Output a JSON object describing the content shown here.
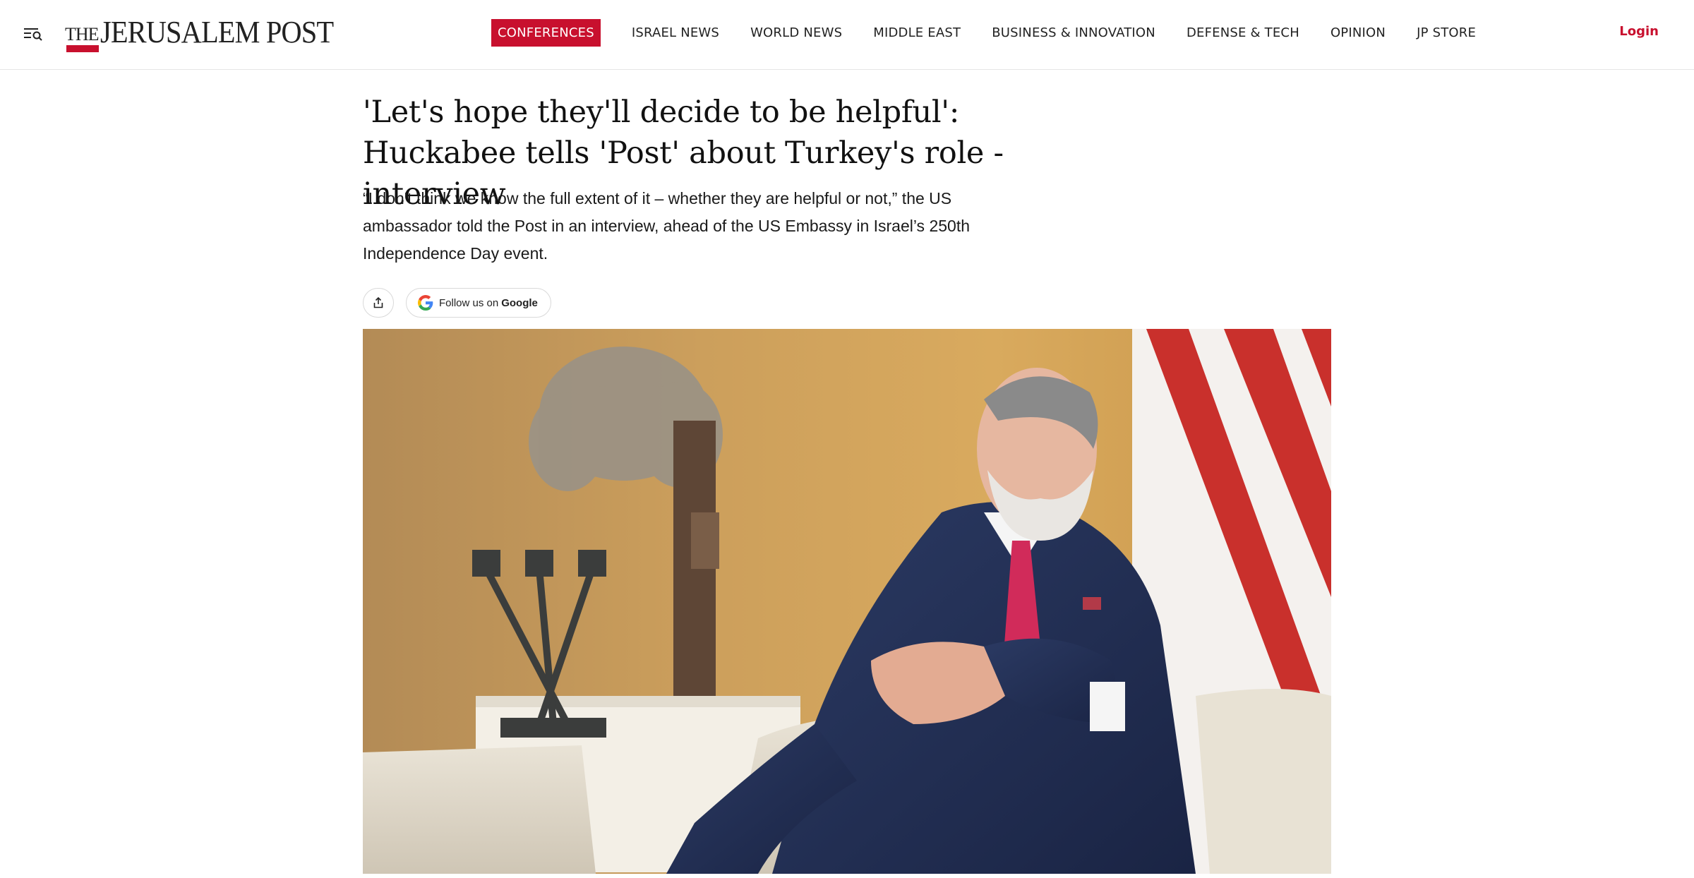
{
  "header": {
    "logo": {
      "the": "THE",
      "name": "JERUSALEM POST"
    },
    "nav": [
      {
        "label": "CONFERENCES",
        "active": true
      },
      {
        "label": "ISRAEL NEWS",
        "active": false
      },
      {
        "label": "WORLD NEWS",
        "active": false
      },
      {
        "label": "MIDDLE EAST",
        "active": false
      },
      {
        "label": "BUSINESS & INNOVATION",
        "active": false
      },
      {
        "label": "DEFENSE & TECH",
        "active": false
      },
      {
        "label": "OPINION",
        "active": false
      },
      {
        "label": "JP STORE",
        "active": false
      }
    ],
    "login_label": "Login"
  },
  "article": {
    "headline": "'Let's hope they'll decide to be helpful': Huckabee tells 'Post' about Turkey's role - interview",
    "subtitle": "“I don't think we know the full extent of it – whether they are helpful or not,” the US ambassador told the Post in an interview, ahead of the US Embassy in Israel’s 250th Independence Day event.",
    "actions": {
      "follow_prefix": "Follow us on",
      "follow_brand": "Google"
    }
  },
  "colors": {
    "brand_red": "#c8102e",
    "text": "#111111",
    "border": "#d9d9d9"
  },
  "icons": {
    "menu": "menu-search-icon",
    "share": "share-icon",
    "google": "google-g-icon"
  }
}
